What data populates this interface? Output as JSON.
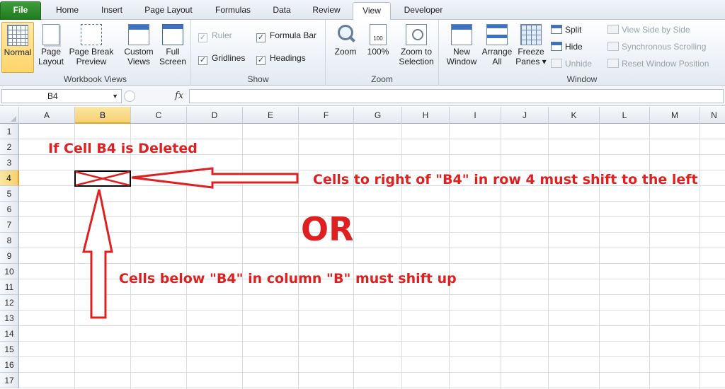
{
  "tabs": [
    "File",
    "Home",
    "Insert",
    "Page Layout",
    "Formulas",
    "Data",
    "Review",
    "View",
    "Developer"
  ],
  "active_tab": "View",
  "ribbon": {
    "workbook_views": {
      "label": "Workbook Views",
      "normal": "Normal",
      "page_layout_1": "Page",
      "page_layout_2": "Layout",
      "page_break_1": "Page Break",
      "page_break_2": "Preview",
      "custom_views_1": "Custom",
      "custom_views_2": "Views",
      "full_screen_1": "Full",
      "full_screen_2": "Screen"
    },
    "show": {
      "label": "Show",
      "ruler": "Ruler",
      "gridlines": "Gridlines",
      "formula_bar": "Formula Bar",
      "headings": "Headings",
      "check": "✓"
    },
    "zoom": {
      "label": "Zoom",
      "zoom": "Zoom",
      "hundred": "100%",
      "hundred_icon": "100",
      "zoom_selection_1": "Zoom to",
      "zoom_selection_2": "Selection"
    },
    "window": {
      "label": "Window",
      "new_window_1": "New",
      "new_window_2": "Window",
      "arrange_all_1": "Arrange",
      "arrange_all_2": "All",
      "freeze_panes_1": "Freeze",
      "freeze_panes_2": "Panes ▾",
      "split": "Split",
      "hide": "Hide",
      "unhide": "Unhide",
      "view_side_by_side": "View Side by Side",
      "synchronous_scrolling": "Synchronous Scrolling",
      "reset_window_position": "Reset Window Position"
    }
  },
  "formula_bar": {
    "name_box": "B4",
    "fx": "fx",
    "value": ""
  },
  "columns": [
    "A",
    "B",
    "C",
    "D",
    "E",
    "F",
    "G",
    "H",
    "I",
    "J",
    "K",
    "L",
    "M",
    "N"
  ],
  "rows": [
    "1",
    "2",
    "3",
    "4",
    "5",
    "6",
    "7",
    "8",
    "9",
    "10",
    "11",
    "12",
    "13",
    "14",
    "15",
    "16",
    "17"
  ],
  "active_cell": {
    "column": "B",
    "row": "4"
  },
  "annotations": {
    "deleted": "If Cell B4 is Deleted",
    "shift_left": "Cells to right of \"B4\" in row 4 must shift to the left",
    "or": "OR",
    "shift_up": "Cells below \"B4\" in column \"B\" must shift up"
  },
  "colors": {
    "annotation": "#e02020",
    "file_tab": "#2e8b2b",
    "selection": "#f6d071"
  }
}
